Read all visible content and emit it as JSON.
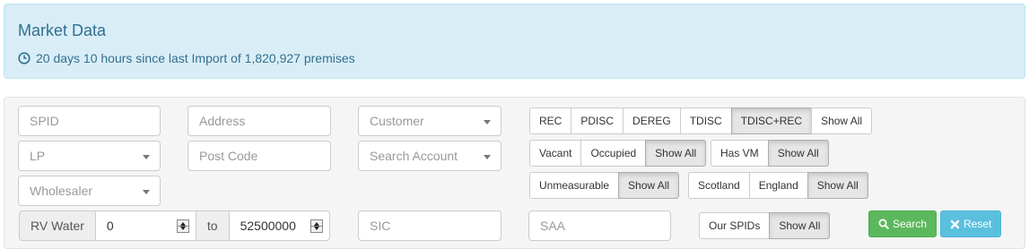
{
  "header": {
    "title": "Market Data",
    "import_status": "20 days 10 hours since last Import of 1,820,927 premises"
  },
  "filters": {
    "spid_placeholder": "SPID",
    "address_placeholder": "Address",
    "customer_label": "Customer",
    "lp_label": "LP",
    "postcode_placeholder": "Post Code",
    "search_account_label": "Search Account",
    "wholesaler_label": "Wholesaler",
    "rv_water_label": "RV Water",
    "rv_from": "0",
    "rv_to_label": "to",
    "rv_to": "52500000",
    "sic_placeholder": "SIC",
    "saa_placeholder": "SAA"
  },
  "status_group": [
    "REC",
    "PDISC",
    "DEREG",
    "TDISC",
    "TDISC+REC",
    "Show All"
  ],
  "occupancy_group": [
    "Vacant",
    "Occupied",
    "Show All"
  ],
  "vm_group": [
    "Has VM",
    "Show All"
  ],
  "measure_group": [
    "Unmeasurable",
    "Show All"
  ],
  "region_group": [
    "Scotland",
    "England",
    "Show All"
  ],
  "spids_group": [
    "Our SPIDs",
    "Show All"
  ],
  "actions": {
    "search_label": "Search",
    "reset_label": "Reset"
  },
  "colors": {
    "alert_bg": "#d9edf7",
    "alert_text": "#31708f",
    "success": "#5cb85c",
    "info": "#5bc0de"
  },
  "icons": {
    "clock": "clock-icon",
    "search": "search-icon",
    "reset": "times-icon"
  }
}
